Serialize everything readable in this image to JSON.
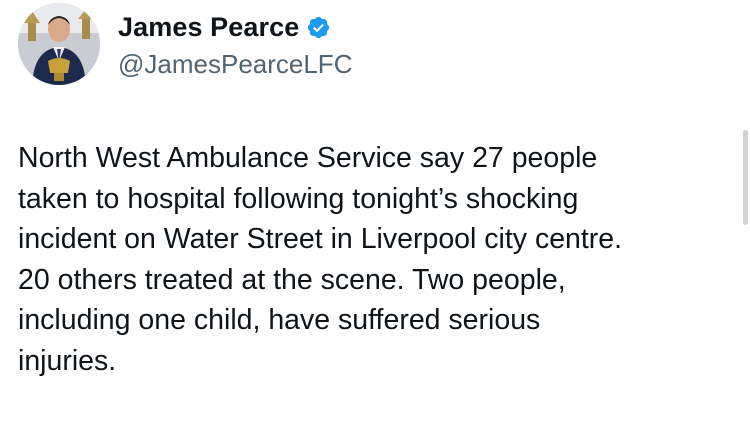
{
  "tweet": {
    "author": {
      "display_name": "James Pearce",
      "handle": "@JamesPearceLFC",
      "verified": true,
      "verified_icon": "verified-badge-icon",
      "avatar_icon": "profile-photo"
    },
    "text_lines": [
      "North West Ambulance Service say 27 people",
      "taken to hospital following tonight’s shocking",
      "incident on Water Street in Liverpool city centre.",
      "20 others treated at the scene. Two people,",
      "including one child, have suffered serious",
      "injuries."
    ]
  },
  "colors": {
    "text": "#0f1419",
    "secondary_text": "#536471",
    "verified_blue": "#1d9bf0",
    "background": "#ffffff"
  }
}
